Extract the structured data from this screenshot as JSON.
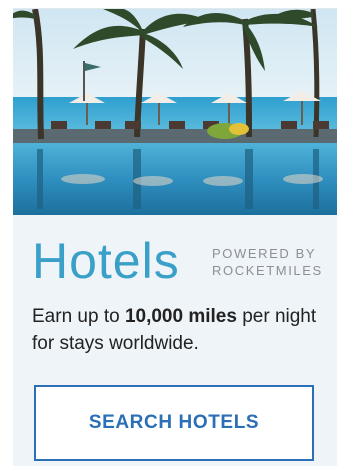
{
  "widget": {
    "image_alt": "Resort pool with palm trees and lounge chairs by the sea",
    "title": "Hotels",
    "powered_by_line1": "POWERED BY",
    "powered_by_line2": "ROCKETMILES",
    "desc_prefix": "Earn up to ",
    "desc_highlight": "10,000 miles",
    "desc_suffix": " per night for stays worldwide.",
    "cta_label": "SEARCH HOTELS",
    "colors": {
      "accent": "#3aa0c8",
      "cta_border": "#2b6fb6",
      "card_bg": "#eef4f8"
    }
  }
}
